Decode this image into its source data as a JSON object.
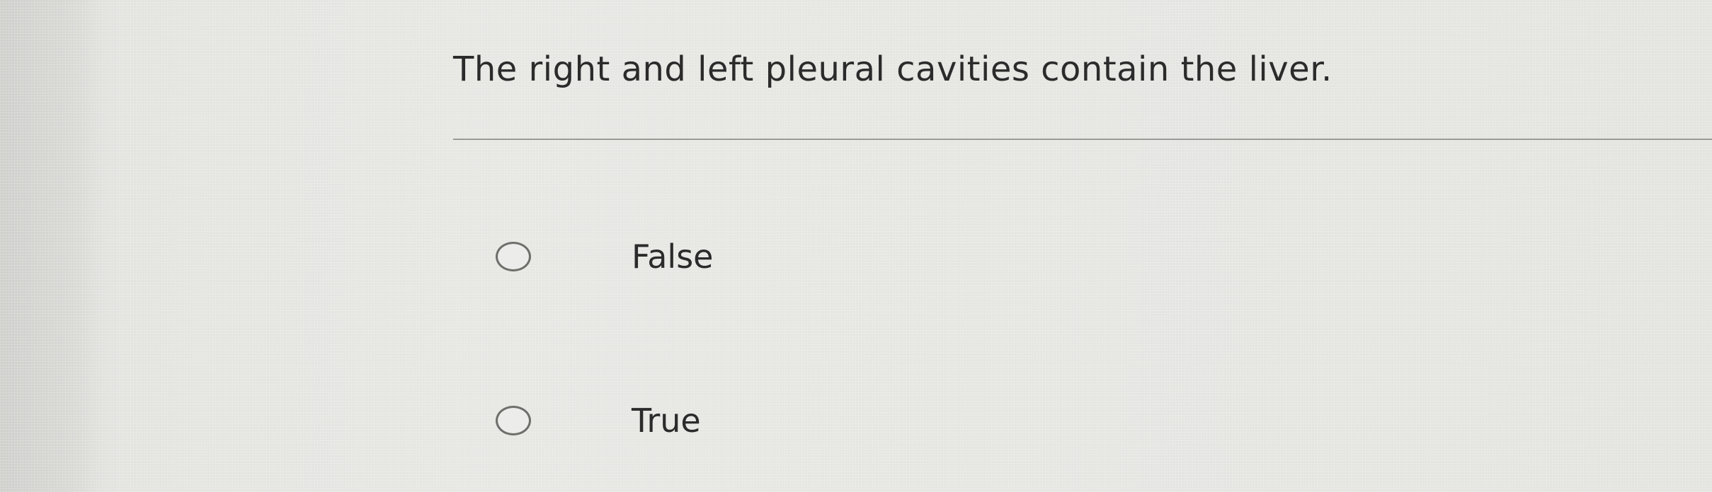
{
  "question": {
    "text": "The right and left pleural cavities contain the liver."
  },
  "options": [
    {
      "label": "False",
      "selected": false
    },
    {
      "label": "True",
      "selected": false
    }
  ],
  "colors": {
    "background": "#e5e5e2",
    "text": "#2b2b2b",
    "radio_border": "#6e6e6b",
    "divider": "#9a9a97"
  }
}
